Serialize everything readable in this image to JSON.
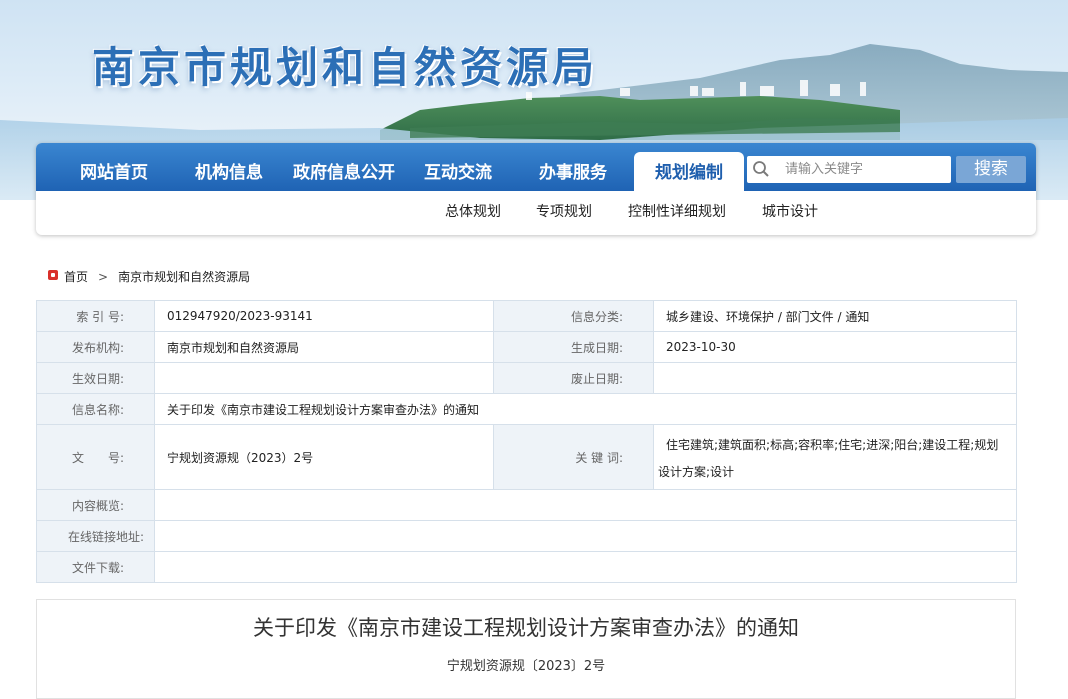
{
  "site": {
    "title": "南京市规划和自然资源局"
  },
  "nav": {
    "items": [
      {
        "label": "网站首页"
      },
      {
        "label": "机构信息"
      },
      {
        "label": "政府信息公开"
      },
      {
        "label": "互动交流"
      },
      {
        "label": "办事服务"
      },
      {
        "label": "规划编制"
      }
    ],
    "active": "规划编制",
    "search": {
      "placeholder": "请输入关键字",
      "button": "搜索"
    },
    "subnav": [
      {
        "label": "总体规划"
      },
      {
        "label": "专项规划"
      },
      {
        "label": "控制性详细规划"
      },
      {
        "label": "城市设计"
      }
    ]
  },
  "breadcrumb": {
    "home": "首页",
    "separator": ">",
    "current": "南京市规划和自然资源局"
  },
  "info": {
    "index_label": "索 引 号:",
    "index_value": "012947920/2023-93141",
    "category_label": "信息分类:",
    "category_value": "城乡建设、环境保护 / 部门文件 / 通知",
    "publisher_label": "发布机构:",
    "publisher_value": "南京市规划和自然资源局",
    "date_label": "生成日期:",
    "date_value": "2023-10-30",
    "effective_label": "生效日期:",
    "effective_value": "",
    "expire_label": "废止日期:",
    "expire_value": "",
    "name_label": "信息名称:",
    "name_value": "关于印发《南京市建设工程规划设计方案审查办法》的通知",
    "docno_label": "文　　号:",
    "docno_value": "宁规划资源规（2023）2号",
    "keywords_label": "关 键 词:",
    "keywords_line1": "住宅建筑;建筑面积;标高;容积率;住宅;进深;阳台;建设工程;规划",
    "keywords_line2": "设计方案;设计",
    "overview_label": "内容概览:",
    "overview_value": "",
    "link_label": "在线链接地址:",
    "link_value": "",
    "download_label": "文件下载:",
    "download_value": ""
  },
  "article": {
    "title": "关于印发《南京市建设工程规划设计方案审查办法》的通知",
    "docno": "宁规划资源规〔2023〕2号"
  },
  "colors": {
    "nav": "#1f63b4",
    "title": "#2c6fb6",
    "label_bg": "#eef3f8",
    "breadcrumb_icon": "#d9302a"
  },
  "icons": {
    "search": "search-icon",
    "breadcrumb": "home-marker-icon"
  }
}
